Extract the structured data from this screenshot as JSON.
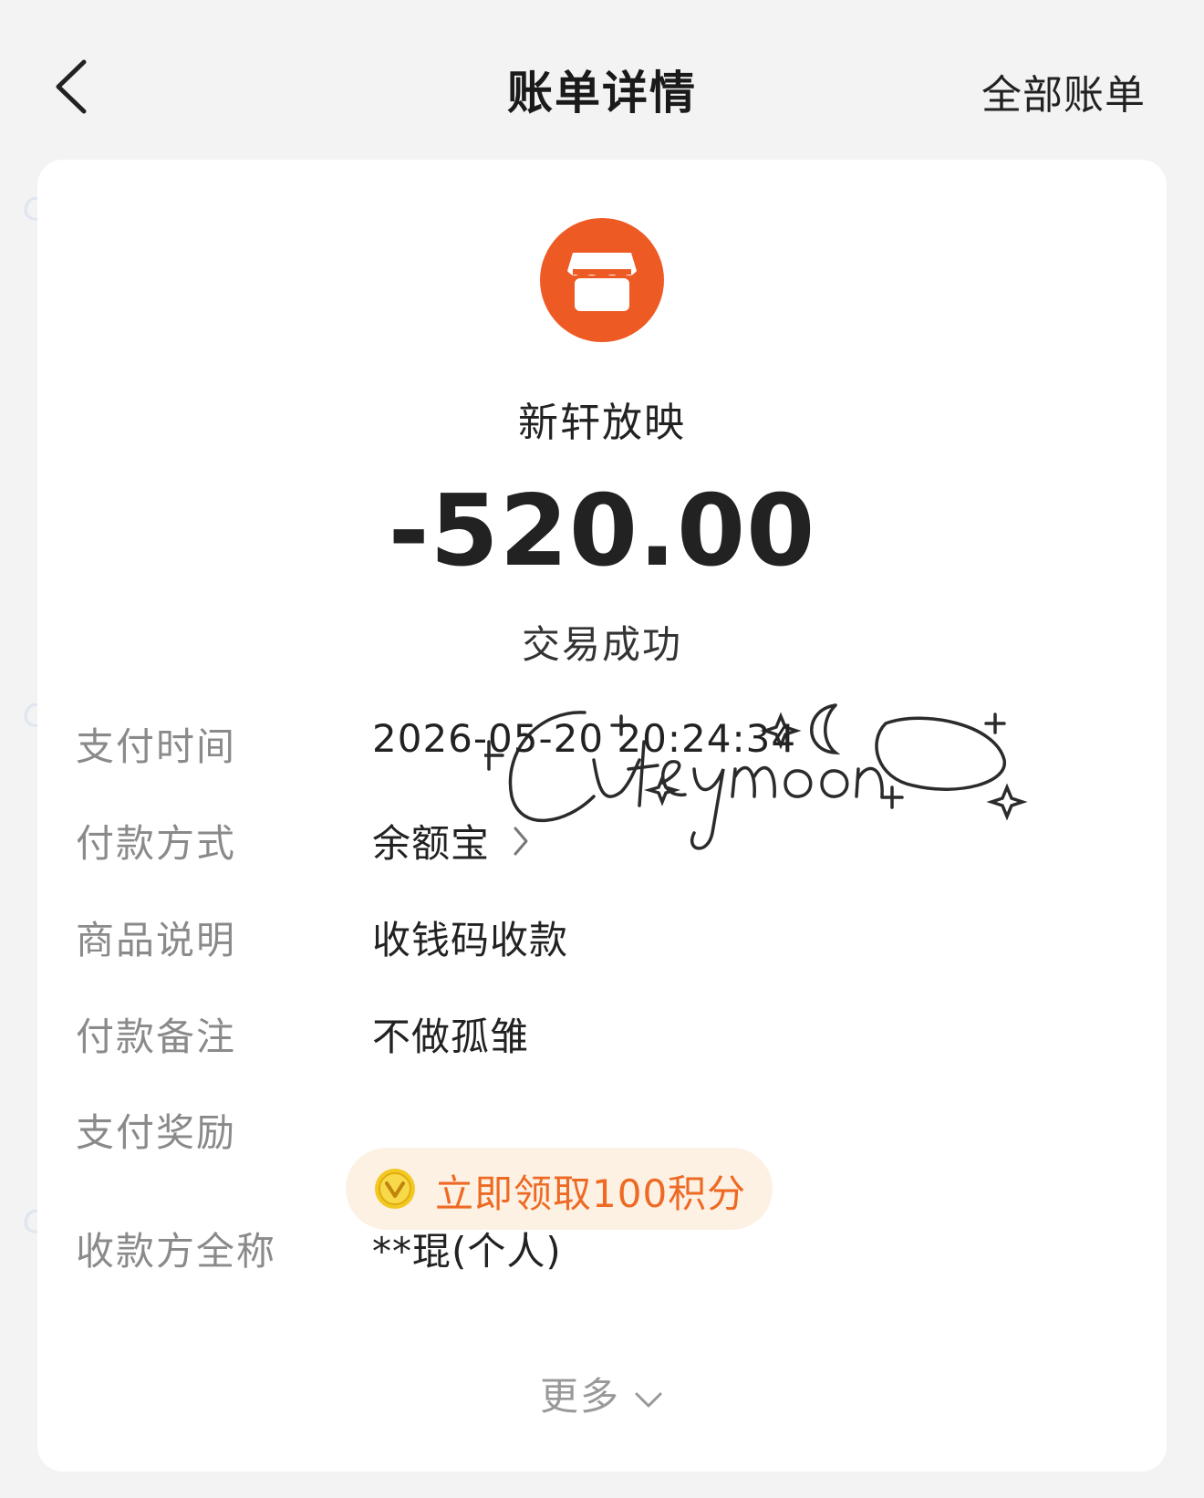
{
  "header": {
    "title": "账单详情",
    "right_link": "全部账单"
  },
  "merchant": {
    "name": "新轩放映",
    "amount": "-520.00",
    "status": "交易成功"
  },
  "details": [
    {
      "label": "支付时间",
      "value": "2026-05-20 20:24:34"
    },
    {
      "label": "付款方式",
      "value": "余额宝"
    },
    {
      "label": "商品说明",
      "value": "收钱码收款"
    },
    {
      "label": "付款备注",
      "value": "不做孤雏"
    },
    {
      "label": "支付奖励",
      "value": "立即领取100积分"
    },
    {
      "label": "收款方全称",
      "value": "**琨(个人)"
    }
  ],
  "more_label": "更多",
  "watermark": "Cuteymoon",
  "colors": {
    "accent": "#ee5a24",
    "reward_bg": "#fdf1e4",
    "reward_text": "#ee6a24",
    "background": "#f3f3f3"
  },
  "icons": {
    "back": "chevron-left-icon",
    "shop": "shop-icon",
    "payment_arrow": "chevron-right-icon",
    "coin": "coin-icon",
    "more": "chevron-down-icon"
  }
}
